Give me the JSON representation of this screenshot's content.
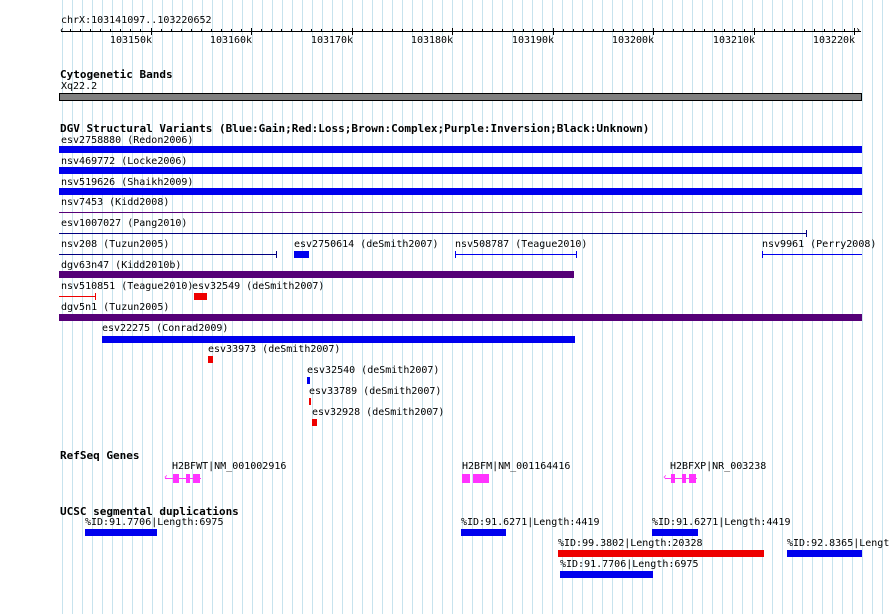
{
  "ruler": {
    "position": "chrX:103141097..103220652",
    "ticks": [
      "103150k",
      "103160k",
      "103170k",
      "103180k",
      "103190k",
      "103200k",
      "103210k",
      "103220k"
    ]
  },
  "cytoband": {
    "title": "Cytogenetic Bands",
    "band": "Xq22.2"
  },
  "dgv": {
    "title": "DGV Structural Variants (Blue:Gain;Red:Loss;Brown:Complex;Purple:Inversion;Black:Unknown)",
    "items": [
      {
        "label": "esv2758880 (Redon2006)"
      },
      {
        "label": "nsv469772 (Locke2006)"
      },
      {
        "label": "nsv519626 (Shaikh2009)"
      },
      {
        "label": "nsv7453 (Kidd2008)"
      },
      {
        "label": "esv1007027 (Pang2010)"
      },
      {
        "label": "nsv208 (Tuzun2005)"
      },
      {
        "label": "esv2750614 (deSmith2007)"
      },
      {
        "label": "nsv508787 (Teague2010)"
      },
      {
        "label": "nsv9961 (Perry2008)"
      },
      {
        "label": "dgv63n47 (Kidd2010b)"
      },
      {
        "label": "nsv510851 (Teague2010)"
      },
      {
        "label": "esv32549 (deSmith2007)"
      },
      {
        "label": "dgv5n1 (Tuzun2005)"
      },
      {
        "label": "esv22275 (Conrad2009)"
      },
      {
        "label": "esv33973 (deSmith2007)"
      },
      {
        "label": "esv32540 (deSmith2007)"
      },
      {
        "label": "esv33789 (deSmith2007)"
      },
      {
        "label": "esv32928 (deSmith2007)"
      }
    ]
  },
  "refseq": {
    "title": "RefSeq Genes",
    "genes": [
      {
        "label": "H2BFWT|NM_001002916"
      },
      {
        "label": "H2BFM|NM_001164416"
      },
      {
        "label": "H2BFXP|NR_003238"
      }
    ]
  },
  "segdups": {
    "title": "UCSC segmental duplications",
    "items": [
      {
        "label": "%ID:91.7706|Length:6975"
      },
      {
        "label": "%ID:91.6271|Length:4419"
      },
      {
        "label": "%ID:91.6271|Length:4419"
      },
      {
        "label": "%ID:99.3802|Length:20328"
      },
      {
        "label": "%ID:92.8365|Lengt"
      },
      {
        "label": "%ID:91.7706|Length:6975"
      }
    ]
  },
  "colors": {
    "gain": "#0000ee",
    "loss": "#ee0000",
    "inversion": "#550077",
    "unknown": "#000080",
    "gene": "#ff33ff",
    "band": "#808080",
    "grid": "#c7e3ee"
  }
}
